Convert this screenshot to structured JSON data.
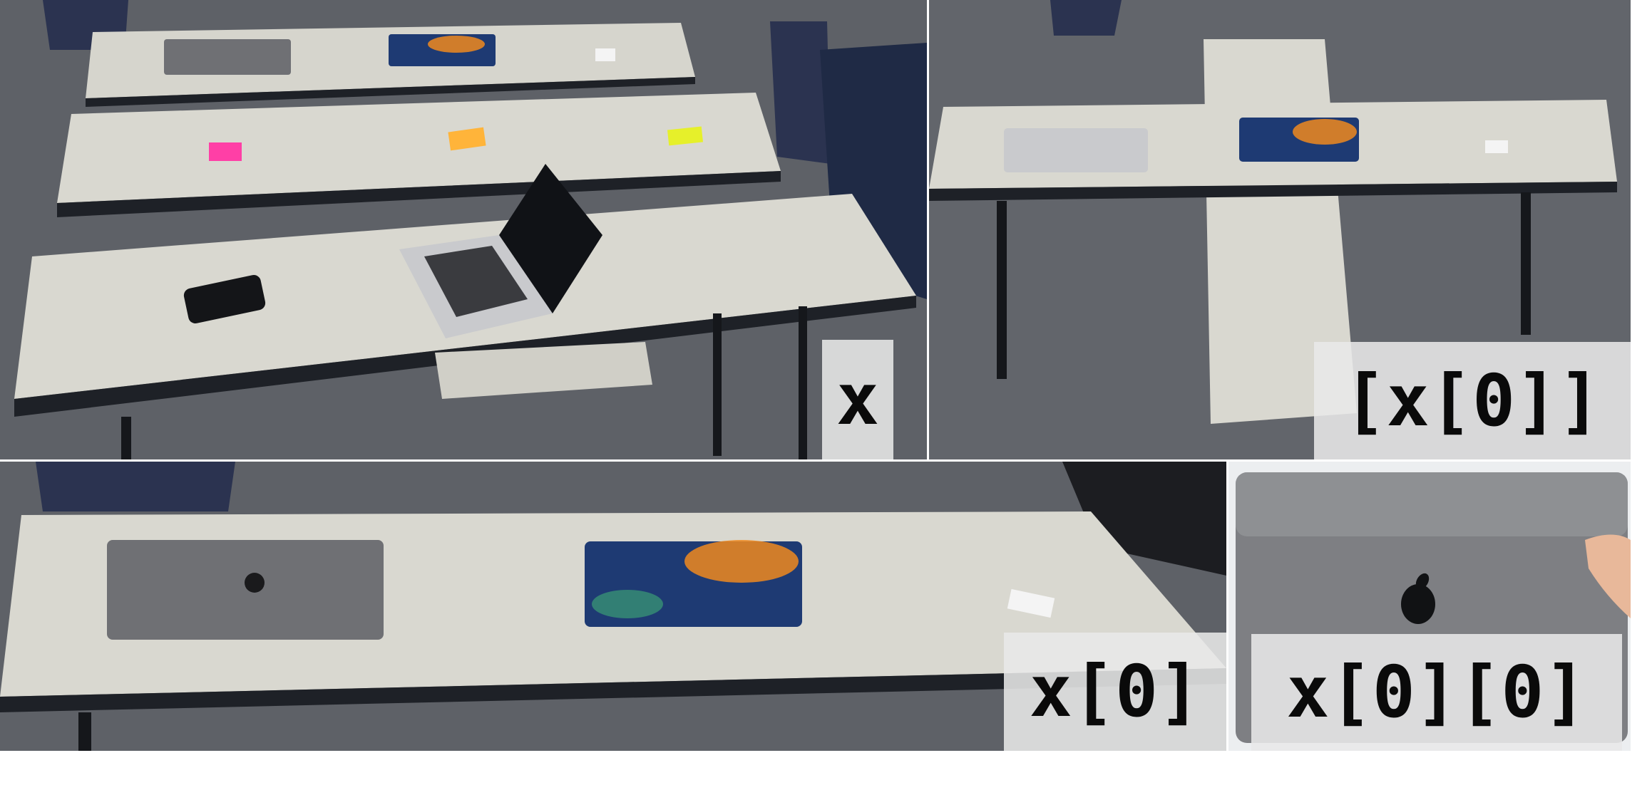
{
  "colors": {
    "carpet": "#5f6268",
    "table_top": "#d9d8d0",
    "table_edge": "#22252b",
    "laptop_silver": "#c9cacd",
    "laptop_space_gray": "#6f7074",
    "galaxy_blue": "#1e3a73",
    "galaxy_orange": "#f08a1f",
    "sticky_pink": "#ff3fa6",
    "sticky_orange": "#ffb43a",
    "sticky_yellow": "#e6f02a",
    "label_bg": "#e8e8e8"
  },
  "panels": {
    "top_left": {
      "label": "x"
    },
    "top_right": {
      "label": "[x[0]]"
    },
    "bottom_left": {
      "label": "x[0]"
    },
    "bottom_right": {
      "label": "x[0][0]"
    }
  }
}
